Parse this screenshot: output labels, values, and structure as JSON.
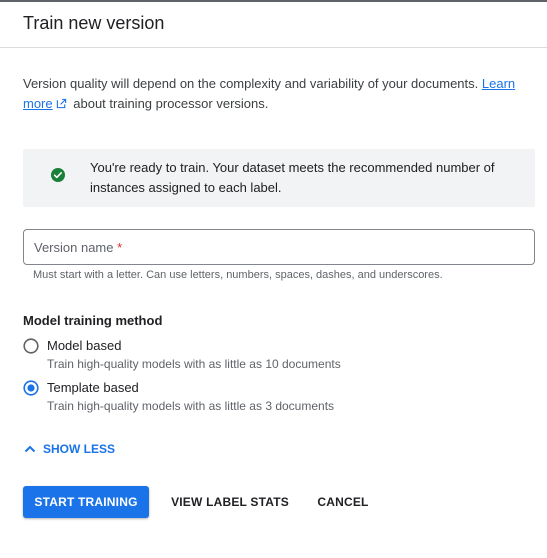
{
  "dialog": {
    "title": "Train new version",
    "intro_text": "Version quality will depend on the complexity and variability of your documents.",
    "learn_more_label": "Learn more",
    "intro_suffix": "about training processor versions."
  },
  "banner": {
    "icon": "check-circle-icon",
    "message": "You're ready to train. Your dataset meets the recommended number of instances assigned to each label."
  },
  "version_name": {
    "label": "Version name",
    "required_marker": "*",
    "value": "",
    "hint": "Must start with a letter. Can use letters, numbers, spaces, dashes, and underscores."
  },
  "training_method": {
    "heading": "Model training method",
    "options": [
      {
        "label": "Model based",
        "description": "Train high-quality models with as little as 10 documents",
        "selected": false
      },
      {
        "label": "Template based",
        "description": "Train high-quality models with as little as 3 documents",
        "selected": true
      }
    ]
  },
  "show_less_label": "SHOW LESS",
  "actions": {
    "start_training": "START TRAINING",
    "view_label_stats": "VIEW LABEL STATS",
    "cancel": "CANCEL"
  },
  "colors": {
    "accent": "#1a73e8",
    "success": "#188038",
    "required": "#d93025"
  }
}
